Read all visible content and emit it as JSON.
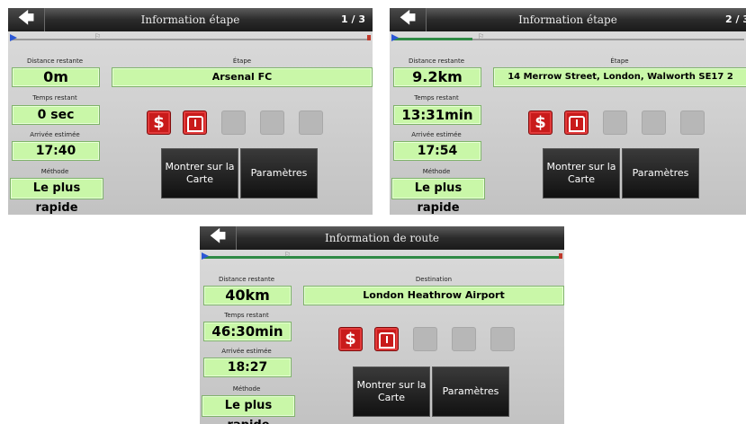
{
  "colors": {
    "value_bg": "#c9f7a8",
    "toll_red": "#c91b1b",
    "route_green": "#2f8a45",
    "titlebar": "#1a1a1a"
  },
  "screens": [
    {
      "title": "Information étape",
      "pager": "1 / 3",
      "progress": 0.0,
      "labels": {
        "distance": "Distance restante",
        "time": "Temps restant",
        "arrival": "Arrivée estimée",
        "method": "Méthode",
        "dest": "Étape"
      },
      "values": {
        "distance": "0m",
        "time": "0 sec",
        "arrival": "17:40",
        "method": "Le plus rapide",
        "dest": "Arsenal FC"
      },
      "buttons": {
        "map": "Montrer sur la Carte",
        "settings": "Paramètres"
      }
    },
    {
      "title": "Information étape",
      "pager": "2 / 3",
      "progress": 0.23,
      "labels": {
        "distance": "Distance restante",
        "time": "Temps restant",
        "arrival": "Arrivée estimée",
        "method": "Méthode",
        "dest": "Étape"
      },
      "values": {
        "distance": "9.2km",
        "time": "13:31min",
        "arrival": "17:54",
        "method": "Le plus rapide",
        "dest": "14 Merrow Street, London, Walworth SE17 2"
      },
      "buttons": {
        "map": "Montrer sur la Carte",
        "settings": "Paramètres"
      }
    },
    {
      "title": "Information de route",
      "pager": "",
      "progress": 1.0,
      "labels": {
        "distance": "Distance restante",
        "time": "Temps restant",
        "arrival": "Arrivée estimée",
        "method": "Méthode",
        "dest": "Destination"
      },
      "values": {
        "distance": "40km",
        "time": "46:30min",
        "arrival": "18:27",
        "method": "Le plus rapide",
        "dest": "London Heathrow Airport"
      },
      "buttons": {
        "map": "Montrer sur la Carte",
        "settings": "Paramètres"
      }
    }
  ],
  "icons": {
    "back": "back-arrow-icon",
    "toll": "toll-road-icon",
    "highway": "highway-icon",
    "empty": "empty-slot-icon"
  }
}
